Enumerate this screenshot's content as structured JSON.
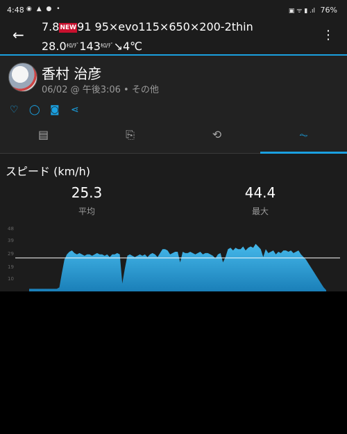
{
  "status_bar": {
    "time": "4:48",
    "left_icons": "◉ ▲ ● •",
    "battery": "76%",
    "right_icons": "▣ ᯤ ▮ .ıl"
  },
  "app_bar": {
    "title_prefix": "7.8",
    "new_badge": "NEW",
    "title_suffix": "91 95×evo115×650×200-2thin",
    "temp1": "28.0",
    "temp1_unit": "ｷﾛ/ﾃﾞ",
    "elevation": "143",
    "elevation_unit": "ｷﾛ/ﾃﾞ",
    "arrow": "↘",
    "temp2": "4℃"
  },
  "profile": {
    "name": "香村 治彦",
    "meta": "06/02 @ 午後3:06 • その他"
  },
  "actions": [
    "heart-icon",
    "comment-icon",
    "camera-icon",
    "share-icon"
  ],
  "tabs": [
    {
      "name": "overview",
      "icon": "▤"
    },
    {
      "name": "details",
      "icon": "⎘"
    },
    {
      "name": "laps",
      "icon": "⟲"
    },
    {
      "name": "charts",
      "icon": "⏦"
    }
  ],
  "speed": {
    "title": "スピード (km/h)",
    "avg_value": "25.3",
    "avg_label": "平均",
    "max_value": "44.4",
    "max_label": "最大"
  },
  "chart_data": {
    "type": "area",
    "ylim": [
      0,
      50
    ],
    "y_ticks": [
      "48",
      "39",
      "29",
      "19",
      "10"
    ],
    "average_line": 25.3,
    "color": "#2aa0d8",
    "values": [
      2,
      2,
      2,
      2,
      2,
      2,
      2,
      2,
      2,
      2,
      2,
      2,
      3,
      14,
      24,
      28,
      30,
      31,
      29,
      28,
      29,
      28,
      27,
      28,
      28,
      27,
      28,
      29,
      28,
      28,
      27,
      28,
      26,
      28,
      28,
      29,
      28,
      6,
      17,
      27,
      28,
      27,
      26,
      27,
      28,
      27,
      28,
      26,
      28,
      29,
      28,
      26,
      29,
      32,
      32,
      31,
      28,
      29,
      30,
      30,
      22,
      30,
      29,
      29,
      30,
      29,
      28,
      29,
      30,
      28,
      29,
      29,
      28,
      27,
      25,
      28,
      29,
      22,
      26,
      32,
      33,
      31,
      33,
      32,
      32,
      34,
      31,
      33,
      34,
      33,
      36,
      34,
      32,
      26,
      32,
      29,
      30,
      31,
      28,
      30,
      29,
      31,
      31,
      30,
      31,
      29,
      30,
      31,
      28,
      26,
      24,
      21,
      18,
      15,
      12,
      9,
      6,
      3,
      1
    ]
  }
}
